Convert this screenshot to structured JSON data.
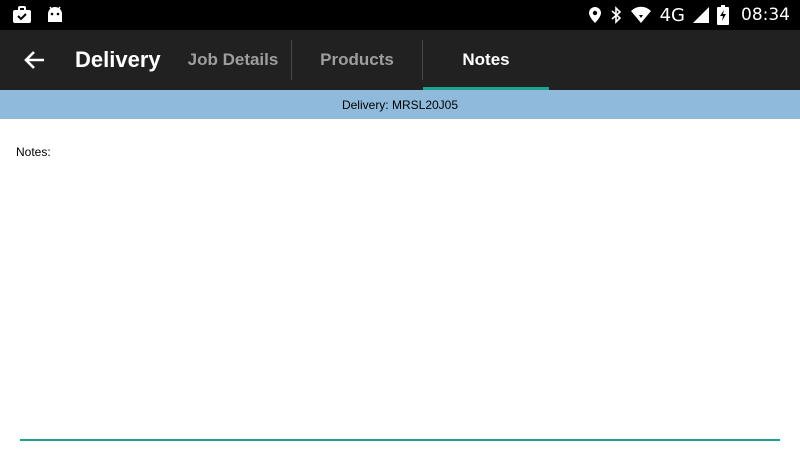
{
  "status_bar": {
    "network": "4G",
    "time": "08:34",
    "icons": [
      "briefcase-check-icon",
      "android-icon",
      "location-icon",
      "bluetooth-icon",
      "wifi-icon",
      "signal-icon",
      "battery-charging-icon"
    ]
  },
  "app_bar": {
    "title": "Delivery",
    "tabs": [
      {
        "label": "Job Details"
      },
      {
        "label": "Products"
      },
      {
        "label": "Notes"
      }
    ],
    "selected_tab": "Notes"
  },
  "sub_header": {
    "text": "Delivery: MRSL20J05"
  },
  "notes": {
    "label": "Notes:",
    "value": "",
    "placeholder": ""
  },
  "colors": {
    "status_bar_bg": "#000000",
    "app_bar_bg": "#212121",
    "accent": "#1aa48f",
    "sub_header_bg": "#8fbadc"
  }
}
